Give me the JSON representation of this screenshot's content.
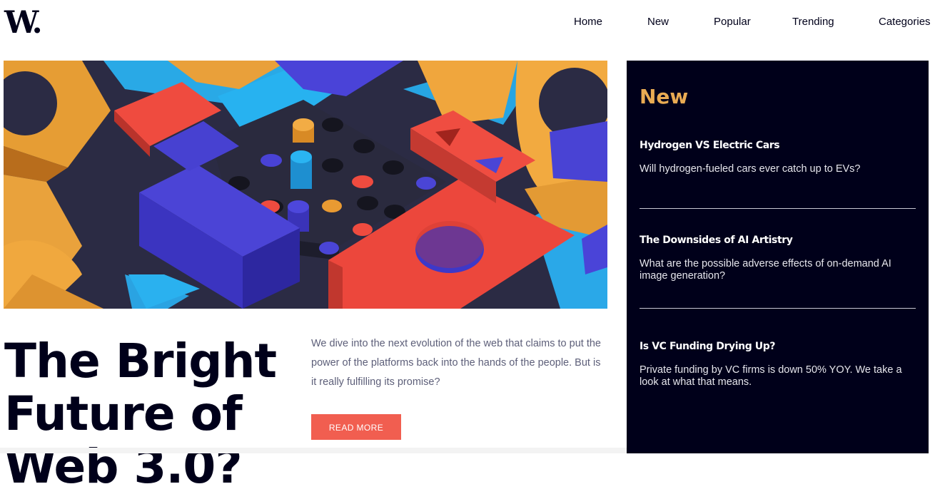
{
  "header": {
    "logo_text": "W.",
    "nav": [
      "Home",
      "New",
      "Popular",
      "Trending",
      "Categories"
    ]
  },
  "hero": {
    "image_alt": "colorful 3D blocks illustration",
    "title": "The Bright Future of Web 3.0?",
    "description": "We dive into the next evolution of the web that claims to put the power of the platforms back into the hands of the people. But is it really fulfilling its promise?",
    "button_label": "READ MORE"
  },
  "sidebar": {
    "heading": "New",
    "items": [
      {
        "title": "Hydrogen VS Electric Cars",
        "description": "Will hydrogen-fueled cars ever catch up to EVs?"
      },
      {
        "title": "The Downsides of AI Artistry",
        "description": "What are the possible adverse effects of on-demand AI image generation?"
      },
      {
        "title": "Is VC Funding Drying Up?",
        "description": "Private funding by VC firms is down 50% YOY. We take a look at what that means."
      }
    ]
  },
  "colors": {
    "navy": "#00001a",
    "accent_orange": "#e9ab53",
    "button_red": "#f15e50",
    "muted_text": "#5d5f79"
  }
}
